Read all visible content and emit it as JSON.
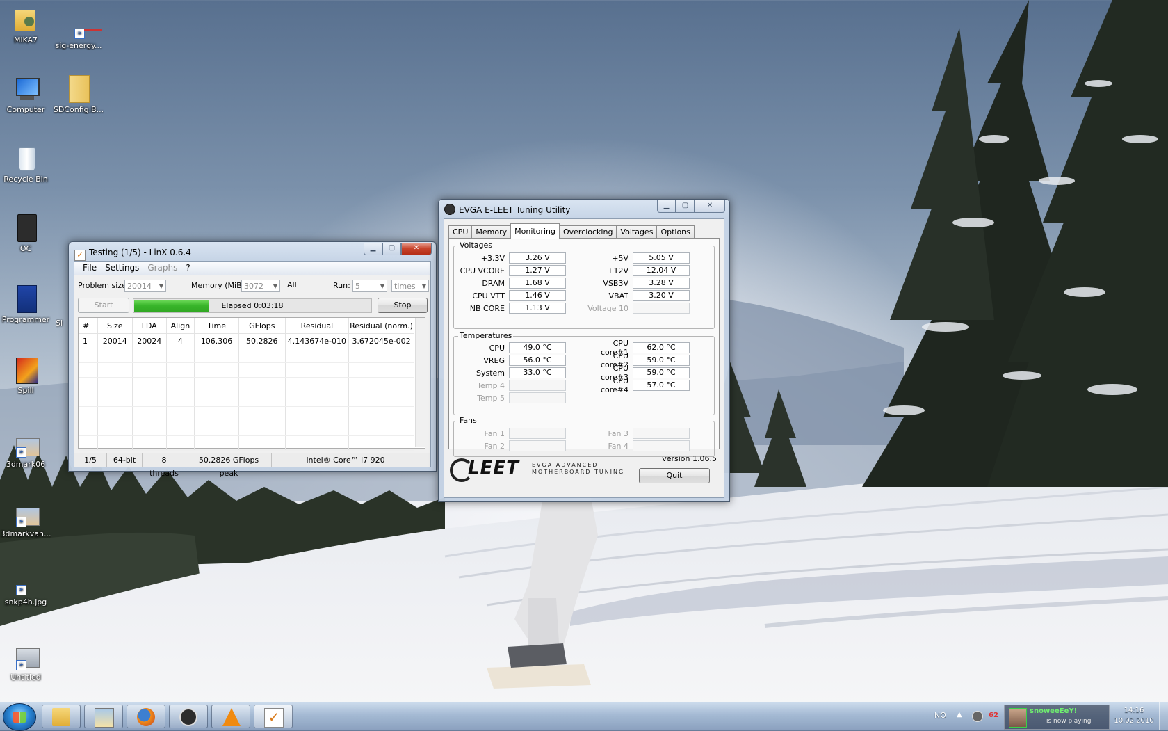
{
  "desktop": {
    "icons": [
      {
        "label": "MiKA7",
        "icon": "user-folder-icon"
      },
      {
        "label": "sig-energy...",
        "icon": "shortcut-icon"
      },
      {
        "label": "Computer",
        "icon": "computer-icon"
      },
      {
        "label": "SDConfig.B...",
        "icon": "folder-icon"
      },
      {
        "label": "Recycle Bin",
        "icon": "recycle-bin-icon"
      },
      {
        "label": "OC",
        "icon": "sd-card-icon"
      },
      {
        "label": "Programmer",
        "icon": "program-icon"
      },
      {
        "label": "Spill",
        "icon": "game-icon"
      },
      {
        "label": "3dmark06",
        "icon": "image-shortcut-icon"
      },
      {
        "label": "3dmarkvan...",
        "icon": "image-shortcut-icon"
      },
      {
        "label": "snkp4h.jpg",
        "icon": "image-shortcut-icon"
      },
      {
        "label": "Untitled",
        "icon": "image-shortcut-icon"
      },
      {
        "label": "Sl",
        "icon": "shortcut-icon"
      }
    ]
  },
  "linx": {
    "title": "Testing (1/5) - LinX 0.6.4",
    "menu": [
      "File",
      "Settings",
      "Graphs",
      "?"
    ],
    "problem_size_label": "Problem size:",
    "problem_size_value": "20014",
    "memory_label": "Memory (MiB):",
    "memory_value": "3072",
    "all_label": "All",
    "run_label": "Run:",
    "run_value": "5",
    "run_unit": "times",
    "start_label": "Start",
    "stop_label": "Stop",
    "progress_fraction": 0.32,
    "elapsed": "Elapsed 0:03:18",
    "columns": [
      "#",
      "Size",
      "LDA",
      "Align",
      "Time",
      "GFlops",
      "Residual",
      "Residual (norm.)"
    ],
    "rows": [
      [
        "1",
        "20014",
        "20024",
        "4",
        "106.306",
        "50.2826",
        "4.143674e-010",
        "3.672045e-002"
      ]
    ],
    "status": [
      "1/5",
      "64-bit",
      "8 threads",
      "50.2826 GFlops peak",
      "Intel® Core™ i7 920"
    ]
  },
  "evga": {
    "title": "EVGA E-LEET Tuning Utility",
    "tabs": [
      "CPU",
      "Memory",
      "Monitoring",
      "Overclocking",
      "Voltages",
      "Options"
    ],
    "active_tab": "Monitoring",
    "voltages_title": "Voltages",
    "voltages_left": [
      {
        "k": "+3.3V",
        "v": "3.26 V"
      },
      {
        "k": "CPU VCORE",
        "v": "1.27 V"
      },
      {
        "k": "DRAM",
        "v": "1.68 V"
      },
      {
        "k": "CPU VTT",
        "v": "1.46 V"
      },
      {
        "k": "NB CORE",
        "v": "1.13 V"
      }
    ],
    "voltages_right": [
      {
        "k": "+5V",
        "v": "5.05 V"
      },
      {
        "k": "+12V",
        "v": "12.04 V"
      },
      {
        "k": "VSB3V",
        "v": "3.28 V"
      },
      {
        "k": "VBAT",
        "v": "3.20 V"
      },
      {
        "k": "Voltage 10",
        "v": ""
      }
    ],
    "temps_title": "Temperatures",
    "temps_left": [
      {
        "k": "CPU",
        "v": "49.0 °C"
      },
      {
        "k": "VREG",
        "v": "56.0 °C"
      },
      {
        "k": "System",
        "v": "33.0 °C"
      },
      {
        "k": "Temp 4",
        "v": ""
      },
      {
        "k": "Temp 5",
        "v": ""
      }
    ],
    "temps_right": [
      {
        "k": "CPU core#1",
        "v": "62.0 °C"
      },
      {
        "k": "CPU core#2",
        "v": "59.0 °C"
      },
      {
        "k": "CPU core#3",
        "v": "59.0 °C"
      },
      {
        "k": "CPU core#4",
        "v": "57.0 °C"
      }
    ],
    "fans_title": "Fans",
    "fans": [
      {
        "k": "Fan 1",
        "v": ""
      },
      {
        "k": "Fan 3",
        "v": ""
      },
      {
        "k": "Fan 2",
        "v": ""
      },
      {
        "k": "Fan 4",
        "v": ""
      }
    ],
    "logo_text": "LEET",
    "logo_sub1": "EVGA ADVANCED",
    "logo_sub2": "MOTHERBOARD TUNING",
    "version": "version 1.06.5",
    "quit_label": "Quit"
  },
  "taskbar": {
    "buttons": [
      "start-orb",
      "explorer",
      "photo-viewer",
      "firefox",
      "evga-eleet",
      "vlc",
      "linx"
    ],
    "language": "NO",
    "tray_temp": "62",
    "now_playing_title": "snoweeEeY!",
    "now_playing_sub": "is now playing",
    "time": "14:16",
    "date": "10.02.2010"
  }
}
